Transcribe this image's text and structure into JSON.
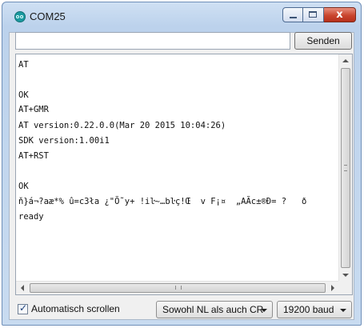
{
  "window": {
    "title": "COM25",
    "close_glyph": "x"
  },
  "toolbar": {
    "send_input_value": "",
    "send_label": "Senden"
  },
  "monitor": {
    "lines": [
      "AT",
      "",
      "OK",
      "AT+GMR",
      "AT version:0.22.0.0(Mar 20 2015 10:04:26)",
      "SDK version:1.00i1",
      "AT+RST",
      "",
      "OK",
      "ň}á¬?aæ*% û=c3ła ¿\"Õ˜y+ !iŀ~…bŀç!Œ  v F¡¤  „AÃc±®Ð= ?   ð",
      "ready"
    ]
  },
  "footer": {
    "autoscroll_label": "Automatisch scrollen",
    "autoscroll_checked": true,
    "line_ending": "Sowohl NL als auch CR",
    "baud": "19200 baud"
  },
  "colors": {
    "titlebar": "#c4d8ef",
    "close_button": "#c9452e"
  },
  "icons": [
    "arduino-icon",
    "minimize-icon",
    "maximize-icon",
    "close-icon",
    "scroll-up-icon",
    "scroll-down-icon",
    "scroll-left-icon",
    "scroll-right-icon",
    "dropdown-caret-icon",
    "checkmark-icon"
  ]
}
